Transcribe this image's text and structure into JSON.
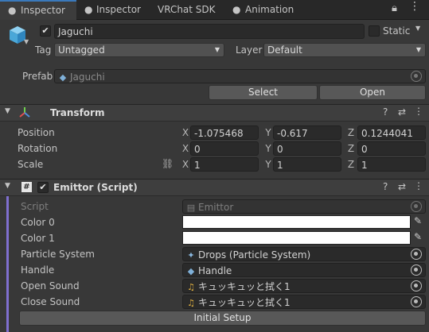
{
  "tabs": [
    {
      "label": "Inspector",
      "icon": "info-icon"
    },
    {
      "label": "Inspector",
      "icon": "info-icon"
    },
    {
      "label": "VRChat SDK"
    },
    {
      "label": "Animation",
      "icon": "animation-icon"
    }
  ],
  "object": {
    "name": "Jaguchi",
    "static_label": "Static",
    "tag_label": "Tag",
    "tag_value": "Untagged",
    "layer_label": "Layer",
    "layer_value": "Default",
    "prefab_label": "Prefab",
    "prefab_value": "Jaguchi",
    "select_label": "Select",
    "open_label": "Open"
  },
  "transform": {
    "title": "Transform",
    "rows": [
      {
        "label": "Position",
        "x": "-1.075468",
        "y": "-0.617",
        "z": "0.1244041"
      },
      {
        "label": "Rotation",
        "x": "0",
        "y": "0",
        "z": "0"
      },
      {
        "label": "Scale",
        "x": "1",
        "y": "1",
        "z": "1"
      }
    ],
    "axes": {
      "x": "X",
      "y": "Y",
      "z": "Z"
    }
  },
  "emitter": {
    "title": "Emittor (Script)",
    "script_label": "Script",
    "script_value": "Emittor",
    "color0_label": "Color 0",
    "color1_label": "Color 1",
    "color0": "#ffffff",
    "color1": "#ffffff",
    "particle_label": "Particle System",
    "particle_value": "Drops (Particle System)",
    "handle_label": "Handle",
    "handle_value": "Handle",
    "open_sound_label": "Open Sound",
    "open_sound_value": "キュッキュッと拭く1",
    "close_sound_label": "Close Sound",
    "close_sound_value": "キュッキュッと拭く1",
    "setup_label": "Initial Setup"
  },
  "colors": {
    "accent": "#3a79bb",
    "field_bg": "#2a2a2a",
    "panel_bg": "#383838",
    "script_bar": "#7f6fcf"
  }
}
